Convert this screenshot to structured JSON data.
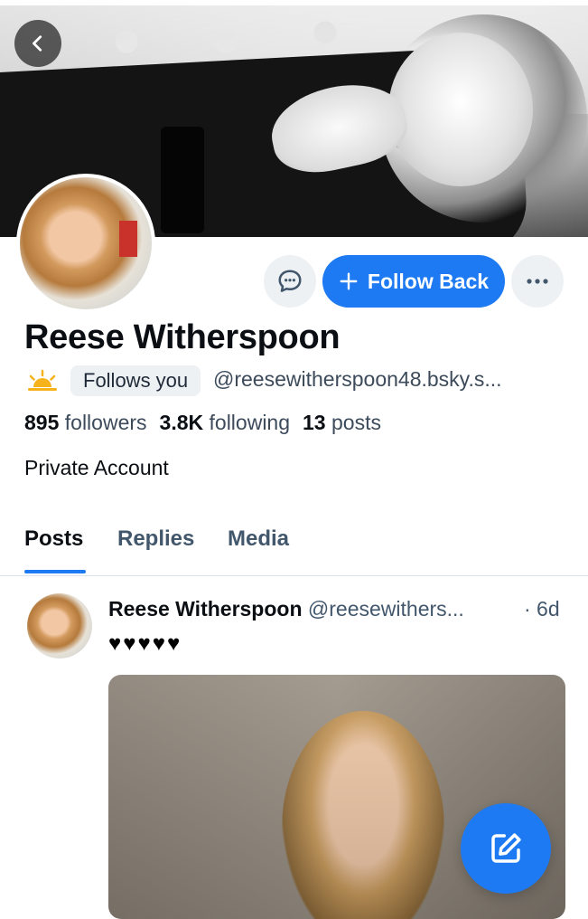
{
  "profile": {
    "display_name": "Reese Witherspoon",
    "follows_you_label": "Follows you",
    "handle": "@reesewitherspoon48.bsky.s...",
    "followers_count": "895",
    "followers_label": "followers",
    "following_count": "3.8K",
    "following_label": "following",
    "posts_count": "13",
    "posts_label": "posts",
    "account_status": "Private Account"
  },
  "actions": {
    "follow_back_label": "Follow Back",
    "follow_plus_icon": "plus-icon",
    "message_icon": "chat-bubble-icon",
    "more_icon": "ellipsis-icon"
  },
  "tabs": [
    {
      "label": "Posts",
      "active": true
    },
    {
      "label": "Replies",
      "active": false
    },
    {
      "label": "Media",
      "active": false
    }
  ],
  "post": {
    "author": "Reese Witherspoon",
    "handle": "@reesewithers...",
    "time": "· 6d",
    "text": "♥♥♥♥♥"
  },
  "colors": {
    "accent": "#1d7af2",
    "muted_text": "#42576c",
    "chip_bg": "#eef1f4"
  }
}
